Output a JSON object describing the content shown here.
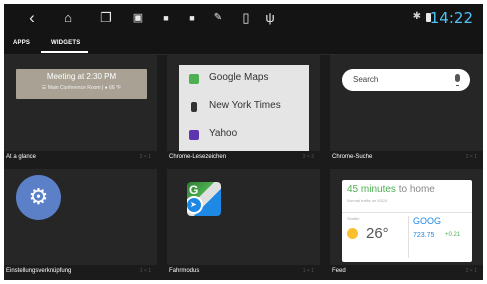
{
  "status_bar": {
    "clock": "14:22",
    "bluetooth": "✱",
    "icons": [
      "back-icon",
      "home-icon",
      "recents-icon",
      "screenshot-icon",
      "app-icon-1",
      "app-icon-2",
      "app-icon-3",
      "phone-icon",
      "usb-icon"
    ]
  },
  "tabs": [
    {
      "label": "APPS",
      "selected": false
    },
    {
      "label": "WIDGETS",
      "selected": true
    }
  ],
  "widgets": [
    {
      "name": "At a glance",
      "size": "2 × 1",
      "preview": {
        "title": "Meeting at 2:30 PM",
        "subtitle": "☰ Main Conference Room | ● 66 °F"
      }
    },
    {
      "name": "Chrome-Lesezeichen",
      "size": "2 × 2",
      "bookmarks": [
        "Google Maps",
        "New York Times",
        "Yahoo"
      ]
    },
    {
      "name": "Chrome-Suche",
      "size": "2 × 1",
      "search_placeholder": "Search"
    },
    {
      "name": "Einstellungsverknüpfung",
      "size": "1 × 1"
    },
    {
      "name": "Fahrmodus",
      "size": "1 × 1"
    },
    {
      "name": "Feed",
      "size": "2 × 1",
      "feed": {
        "minutes": "45 minutes",
        "to_home": " to home",
        "traffic": "Normal traffic on I0024",
        "weather_label": "Seattle",
        "temp": "26°",
        "stock_label": "GOOG",
        "stock_value": "723.75",
        "stock_change": "+0.21"
      }
    }
  ],
  "colors": {
    "accent": "#4fc3f7",
    "background": "#1b1b1b",
    "panel": "#262626"
  }
}
